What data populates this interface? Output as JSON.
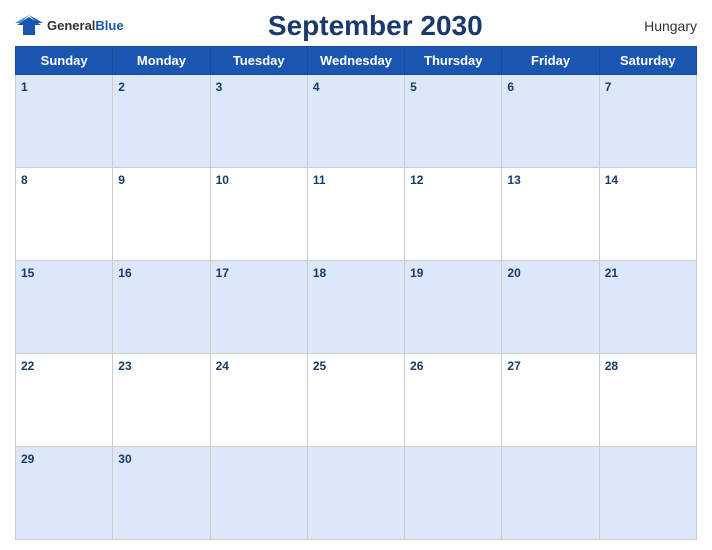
{
  "header": {
    "logo_general": "General",
    "logo_blue": "Blue",
    "title": "September 2030",
    "country": "Hungary"
  },
  "days_of_week": [
    "Sunday",
    "Monday",
    "Tuesday",
    "Wednesday",
    "Thursday",
    "Friday",
    "Saturday"
  ],
  "weeks": [
    [
      {
        "num": "1",
        "empty": false
      },
      {
        "num": "2",
        "empty": false
      },
      {
        "num": "3",
        "empty": false
      },
      {
        "num": "4",
        "empty": false
      },
      {
        "num": "5",
        "empty": false
      },
      {
        "num": "6",
        "empty": false
      },
      {
        "num": "7",
        "empty": false
      }
    ],
    [
      {
        "num": "8",
        "empty": false
      },
      {
        "num": "9",
        "empty": false
      },
      {
        "num": "10",
        "empty": false
      },
      {
        "num": "11",
        "empty": false
      },
      {
        "num": "12",
        "empty": false
      },
      {
        "num": "13",
        "empty": false
      },
      {
        "num": "14",
        "empty": false
      }
    ],
    [
      {
        "num": "15",
        "empty": false
      },
      {
        "num": "16",
        "empty": false
      },
      {
        "num": "17",
        "empty": false
      },
      {
        "num": "18",
        "empty": false
      },
      {
        "num": "19",
        "empty": false
      },
      {
        "num": "20",
        "empty": false
      },
      {
        "num": "21",
        "empty": false
      }
    ],
    [
      {
        "num": "22",
        "empty": false
      },
      {
        "num": "23",
        "empty": false
      },
      {
        "num": "24",
        "empty": false
      },
      {
        "num": "25",
        "empty": false
      },
      {
        "num": "26",
        "empty": false
      },
      {
        "num": "27",
        "empty": false
      },
      {
        "num": "28",
        "empty": false
      }
    ],
    [
      {
        "num": "29",
        "empty": false
      },
      {
        "num": "30",
        "empty": false
      },
      {
        "num": "",
        "empty": true
      },
      {
        "num": "",
        "empty": true
      },
      {
        "num": "",
        "empty": true
      },
      {
        "num": "",
        "empty": true
      },
      {
        "num": "",
        "empty": true
      }
    ]
  ]
}
